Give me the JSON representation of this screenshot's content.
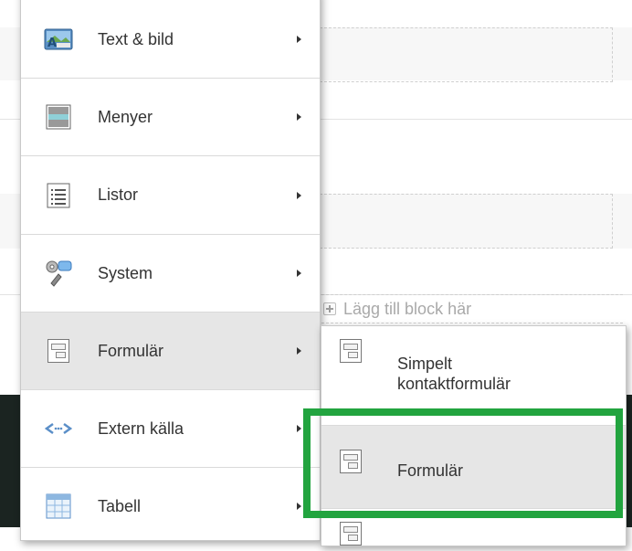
{
  "main_menu": {
    "items": [
      {
        "label": "Text & bild",
        "icon": "image-text-icon"
      },
      {
        "label": "Menyer",
        "icon": "menu-layout-icon"
      },
      {
        "label": "Listor",
        "icon": "list-icon"
      },
      {
        "label": "System",
        "icon": "system-settings-icon"
      },
      {
        "label": "Formulär",
        "icon": "form-icon"
      },
      {
        "label": "Extern källa",
        "icon": "external-source-icon"
      },
      {
        "label": "Tabell",
        "icon": "table-icon"
      }
    ]
  },
  "sub_menu": {
    "items": [
      {
        "label": "Simpelt kontaktformulär",
        "icon": "form-icon"
      },
      {
        "label": "Formulär",
        "icon": "form-icon"
      }
    ]
  },
  "page": {
    "add_block_label": "Lägg till block här"
  },
  "colors": {
    "highlight_frame": "#22a43f",
    "selected_bg": "#e6e6e6",
    "dark_bar": "#1b2421"
  }
}
